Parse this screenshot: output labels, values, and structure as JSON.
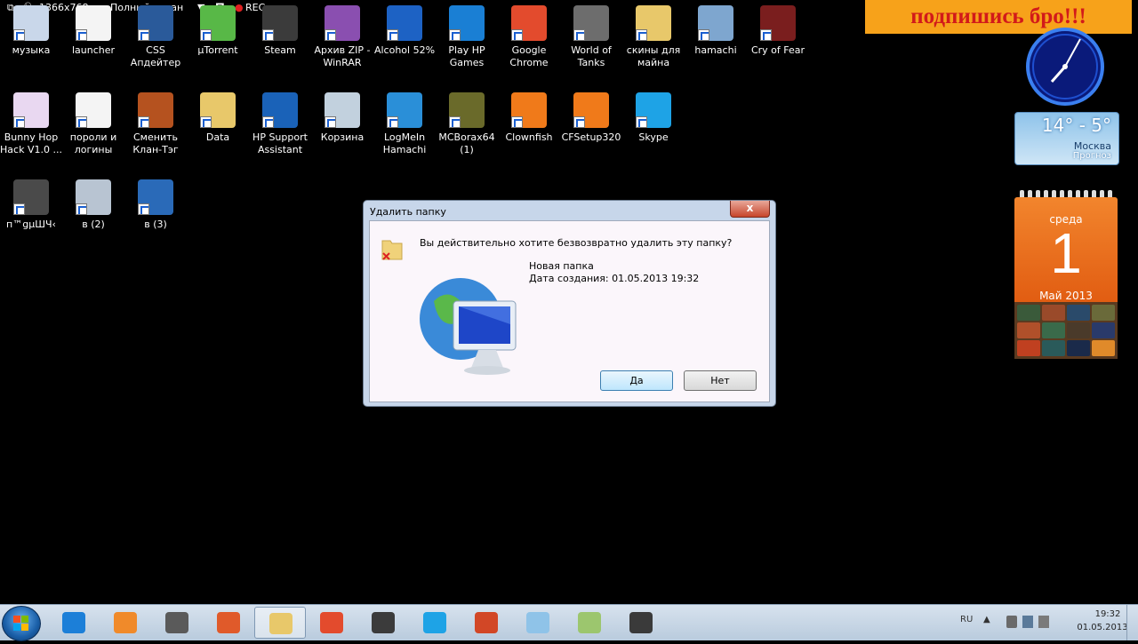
{
  "recorder": {
    "resolution": "1366x768",
    "mode": "Полный экран",
    "rec": "REC"
  },
  "banner": {
    "text": "подпишись бро!!!"
  },
  "desktop_icons": [
    {
      "label": "музыка",
      "icon": "music-file-icon",
      "color": "#c9d7ea"
    },
    {
      "label": "launcher",
      "icon": "java-file-icon",
      "color": "#f4f4f4"
    },
    {
      "label": "CSS Апдейтер",
      "icon": "css-logo-icon",
      "color": "#2a5a9a"
    },
    {
      "label": "µTorrent",
      "icon": "utorrent-icon",
      "color": "#58b847"
    },
    {
      "label": "Steam",
      "icon": "steam-icon",
      "color": "#3b3b3b"
    },
    {
      "label": "Архив ZIP - WinRAR",
      "icon": "winrar-icon",
      "color": "#8a4fb0"
    },
    {
      "label": "Alcohol 52%",
      "icon": "alcohol-icon",
      "color": "#1d62c4"
    },
    {
      "label": "Play HP Games",
      "icon": "hp-games-icon",
      "color": "#1a7fd4"
    },
    {
      "label": "Google Chrome",
      "icon": "chrome-icon",
      "color": "#e34b2d"
    },
    {
      "label": "World of Tanks",
      "icon": "wot-icon",
      "color": "#6d6d6d"
    },
    {
      "label": "скины для майна",
      "icon": "folder-icon",
      "color": "#e8c86a"
    },
    {
      "label": "hamachi",
      "icon": "installer-icon",
      "color": "#7ea6cf"
    },
    {
      "label": "Cry of Fear",
      "icon": "phone-icon",
      "color": "#7a1e1e"
    },
    {
      "label": "Bunny Hop Hack V1.0 ...",
      "icon": "bunny-icon",
      "color": "#e9d8f1"
    },
    {
      "label": "пороли и логины",
      "icon": "text-file-icon",
      "color": "#f4f4f4"
    },
    {
      "label": "Сменить Клан-Тэг",
      "icon": "tf2-icon",
      "color": "#b5521f"
    },
    {
      "label": "Data",
      "icon": "folder-icon",
      "color": "#e8c86a"
    },
    {
      "label": "HP Support Assistant",
      "icon": "help-icon",
      "color": "#1a62b8"
    },
    {
      "label": "Корзина",
      "icon": "recycle-bin-icon",
      "color": "#c2d1de"
    },
    {
      "label": "LogMeIn Hamachi",
      "icon": "hamachi-icon",
      "color": "#2a8fd8"
    },
    {
      "label": "MCBorax64 (1)",
      "icon": "minecraft-icon",
      "color": "#6a6a2a"
    },
    {
      "label": "Clownfish",
      "icon": "clownfish-icon",
      "color": "#f07a1a"
    },
    {
      "label": "CFSetup320",
      "icon": "clownfish-setup-icon",
      "color": "#f07a1a"
    },
    {
      "label": "Skype",
      "icon": "skype-icon",
      "color": "#1ea3e6"
    },
    {
      "label": "п™gµШЧ‹",
      "icon": "phone-icon",
      "color": "#4a4a4a"
    },
    {
      "label": "в (2)",
      "icon": "camcorder-icon",
      "color": "#b8c4d2"
    },
    {
      "label": "в (3)",
      "icon": "computer-icon",
      "color": "#2a6ab8"
    }
  ],
  "gadgets": {
    "weather": {
      "temp": "14° - 5°",
      "city": "Москва",
      "forecast": "Прогноз"
    },
    "calendar": {
      "weekday": "среда",
      "day": "1",
      "month": "Май 2013"
    }
  },
  "dialog": {
    "title": "Удалить папку",
    "close": "x",
    "question": "Вы действительно хотите безвозвратно удалить эту папку?",
    "folder_name": "Новая папка",
    "created": "Дата создания: 01.05.2013 19:32",
    "yes": "Да",
    "no": "Нет"
  },
  "taskbar": {
    "apps": [
      {
        "icon": "internet-explorer-icon",
        "color": "#1c7fd8"
      },
      {
        "icon": "media-player-icon",
        "color": "#f08a2a"
      },
      {
        "icon": "hp-icon",
        "color": "#5a5a5a"
      },
      {
        "icon": "installer-box-icon",
        "color": "#e05a2a"
      },
      {
        "icon": "explorer-folder-icon",
        "color": "#e8c86a"
      },
      {
        "icon": "chrome-icon",
        "color": "#e34b2d"
      },
      {
        "icon": "steam-icon",
        "color": "#3b3b3b"
      },
      {
        "icon": "skype-icon",
        "color": "#1ea3e6"
      },
      {
        "icon": "powerpoint-icon",
        "color": "#d24726"
      },
      {
        "icon": "notepad-icon",
        "color": "#8fc3e8"
      },
      {
        "icon": "wordpad-icon",
        "color": "#9cc66e"
      },
      {
        "icon": "camcorder-icon",
        "color": "#3a3a3a"
      }
    ],
    "lang": "RU",
    "time": "19:32",
    "date": "01.05.2013"
  }
}
